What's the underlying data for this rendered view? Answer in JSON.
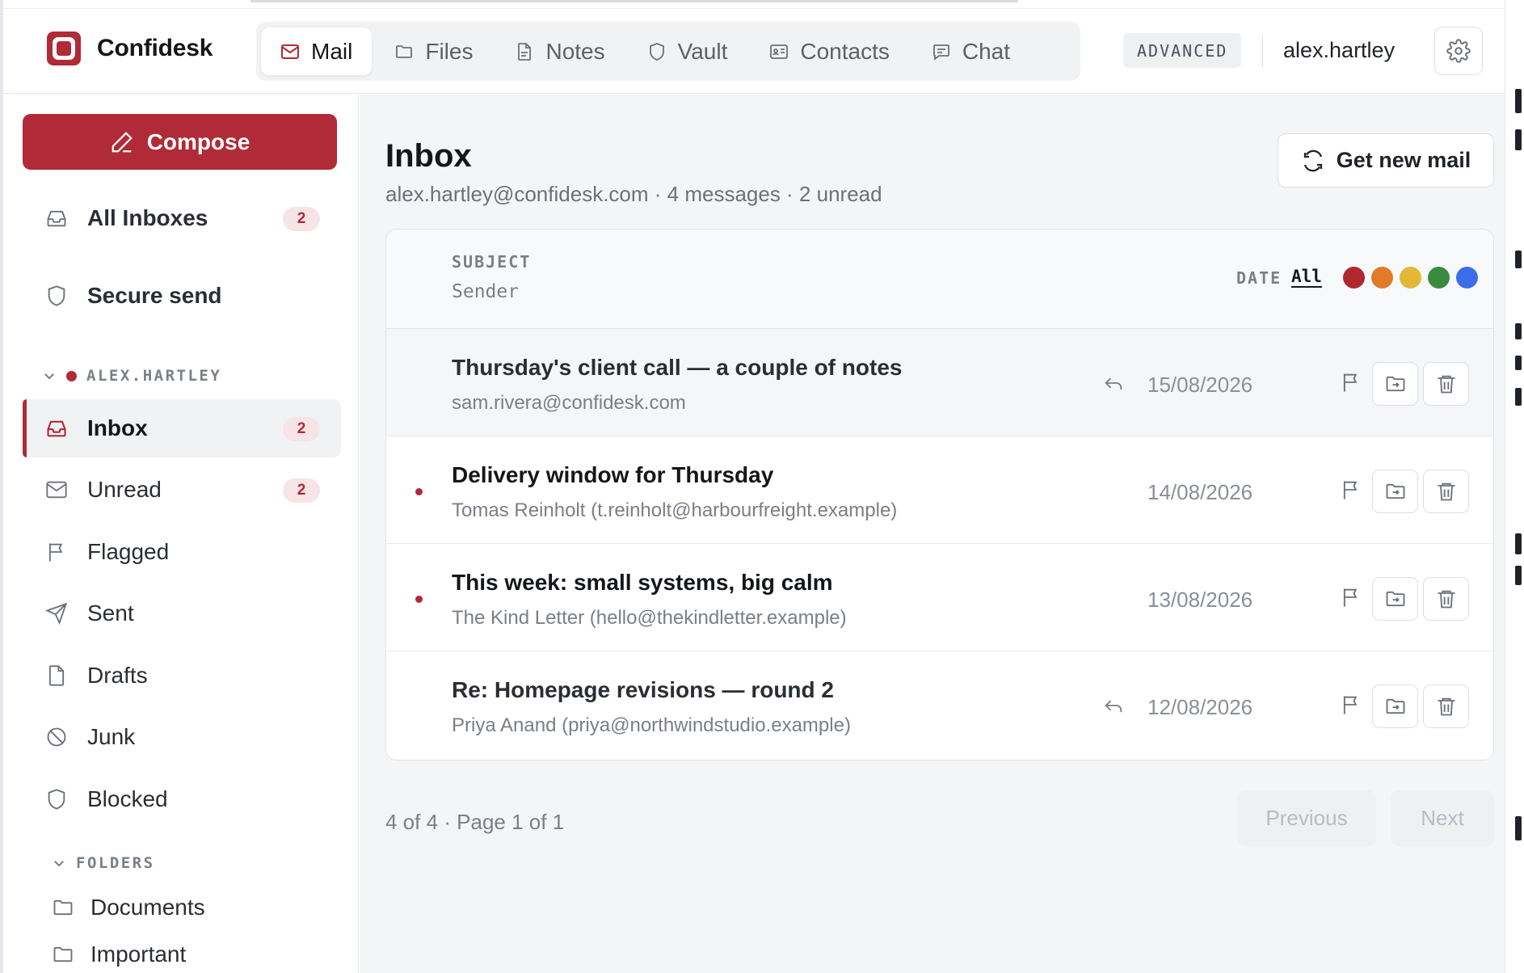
{
  "app": {
    "name": "Confidesk"
  },
  "nav": {
    "tabs": [
      {
        "label": "Mail",
        "icon": "mail-icon",
        "active": true
      },
      {
        "label": "Files",
        "icon": "folder-icon",
        "active": false
      },
      {
        "label": "Notes",
        "icon": "note-icon",
        "active": false
      },
      {
        "label": "Vault",
        "icon": "shield-icon",
        "active": false
      },
      {
        "label": "Contacts",
        "icon": "contact-card-icon",
        "active": false
      },
      {
        "label": "Chat",
        "icon": "chat-icon",
        "active": false
      }
    ]
  },
  "header": {
    "plan_badge": "ADVANCED",
    "username": "alex.hartley",
    "settings_icon": "gear-icon"
  },
  "sidebar": {
    "compose_label": "Compose",
    "top_items": [
      {
        "label": "All Inboxes",
        "icon": "inbox-icon",
        "count": "2"
      },
      {
        "label": "Secure send",
        "icon": "shield-icon"
      }
    ],
    "account_label": "ALEX.HARTLEY",
    "account_items": [
      {
        "label": "Inbox",
        "icon": "inbox-icon",
        "count": "2",
        "active": true
      },
      {
        "label": "Unread",
        "icon": "mail-icon",
        "count": "2"
      },
      {
        "label": "Flagged",
        "icon": "flag-icon"
      },
      {
        "label": "Sent",
        "icon": "send-icon"
      },
      {
        "label": "Drafts",
        "icon": "file-icon"
      },
      {
        "label": "Junk",
        "icon": "block-icon"
      },
      {
        "label": "Blocked",
        "icon": "shield-icon"
      }
    ],
    "folders_label": "FOLDERS",
    "folders": [
      {
        "label": "Documents",
        "icon": "folder-icon"
      },
      {
        "label": "Important",
        "icon": "folder-icon"
      }
    ]
  },
  "main": {
    "title": "Inbox",
    "subtitle": "alex.hartley@confidesk.com · 4 messages · 2 unread",
    "get_new_mail_label": "Get new mail",
    "columns": {
      "subject": "SUBJECT",
      "sender": "Sender",
      "date": "DATE",
      "filter_all": "All",
      "color_filters": [
        "#b0272f",
        "#e07b2a",
        "#e3b836",
        "#3b8a3e",
        "#3b6ee8"
      ]
    },
    "messages": [
      {
        "subject": "Thursday's client call — a couple of notes",
        "sender": "sam.rivera@confidesk.com",
        "date": "15/08/2026",
        "unread": false,
        "replied": true,
        "highlight": true
      },
      {
        "subject": "Delivery window for Thursday",
        "sender": "Tomas Reinholt (t.reinholt@harbourfreight.example)",
        "date": "14/08/2026",
        "unread": true,
        "replied": false,
        "highlight": false
      },
      {
        "subject": "This week: small systems, big calm",
        "sender": "The Kind Letter (hello@thekindletter.example)",
        "date": "13/08/2026",
        "unread": true,
        "replied": false,
        "highlight": false
      },
      {
        "subject": "Re: Homepage revisions — round 2",
        "sender": "Priya Anand (priya@northwindstudio.example)",
        "date": "12/08/2026",
        "unread": false,
        "replied": true,
        "highlight": false
      }
    ],
    "pagination": {
      "info": "4 of 4 · Page 1 of 1",
      "previous_label": "Previous",
      "next_label": "Next"
    }
  },
  "colors": {
    "accent": "#b02a37",
    "badge_bg": "#f7e4e6"
  }
}
